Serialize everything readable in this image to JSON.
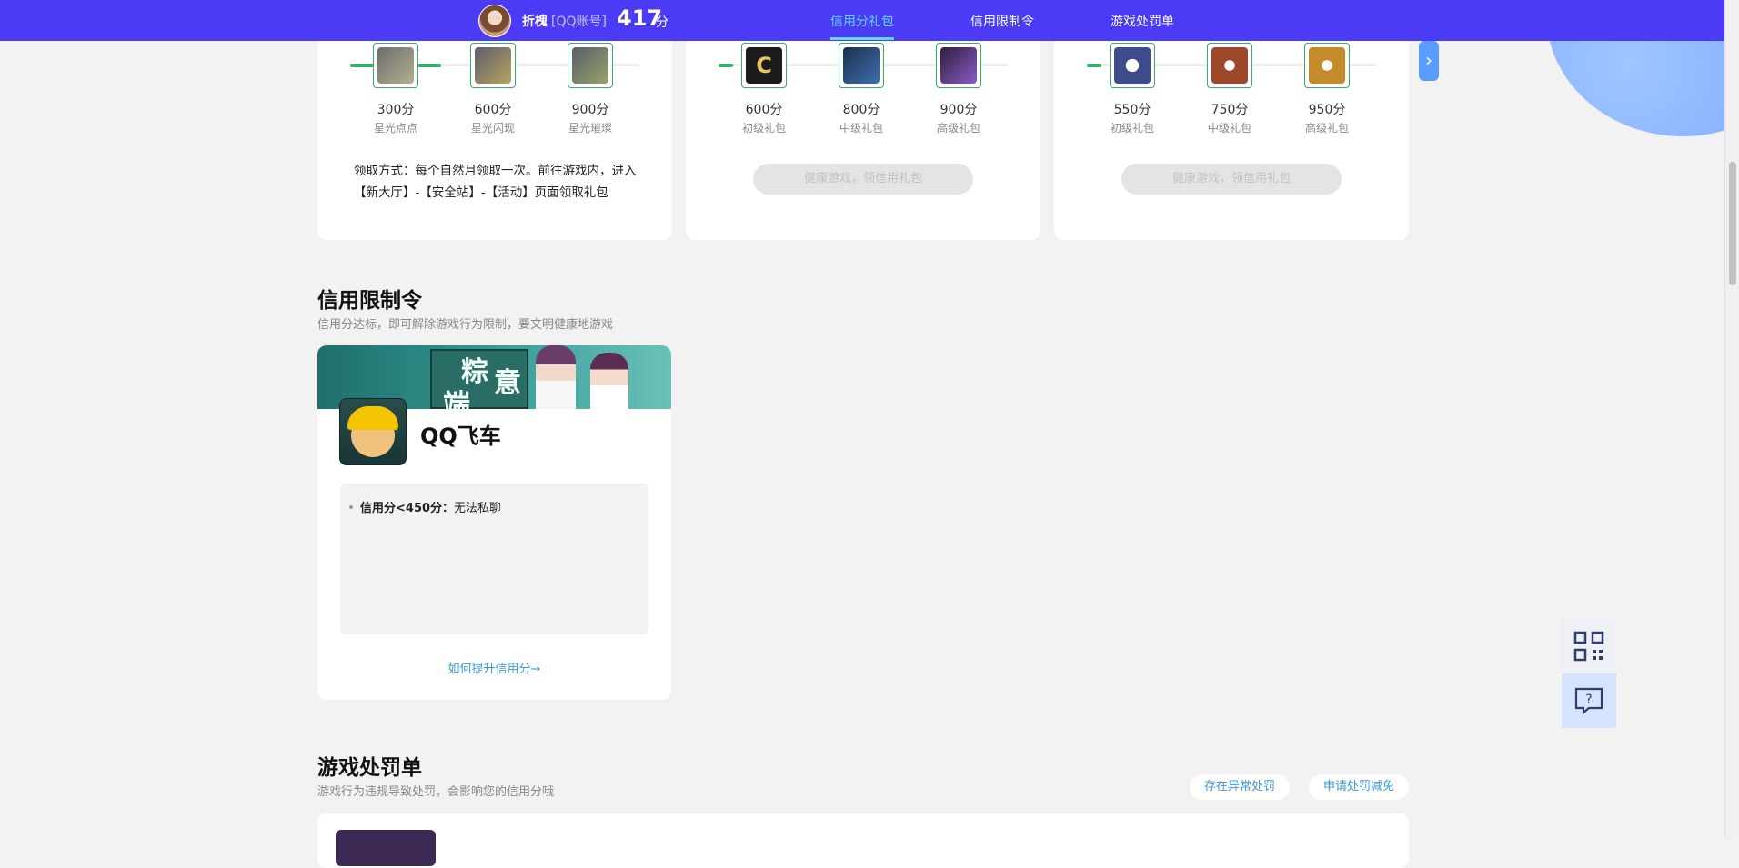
{
  "header": {
    "user_name": "折槐",
    "account_type": "[QQ账号]",
    "score": "417",
    "score_unit": "分",
    "tabs": [
      {
        "label": "信用分礼包",
        "active": true
      },
      {
        "label": "信用限制令",
        "active": false
      },
      {
        "label": "游戏处罚单",
        "active": false
      }
    ],
    "accent_color": "#4c3bf5",
    "active_tab_color": "#5fd7ff"
  },
  "gift_cards": [
    {
      "rewards": [
        {
          "points": "300分",
          "name": "星光点点",
          "icon": "starlight-dot-icon"
        },
        {
          "points": "600分",
          "name": "星光闪现",
          "icon": "starlight-flash-icon"
        },
        {
          "points": "900分",
          "name": "星光璀璨",
          "icon": "starlight-brilliant-icon"
        }
      ],
      "claim_text": "领取方式：每个自然月领取一次。前往游戏内，进入【新大厅】-【安全站】-【活动】页面领取礼包"
    },
    {
      "rewards": [
        {
          "points": "600分",
          "name": "初级礼包",
          "icon": "c-badge-icon"
        },
        {
          "points": "800分",
          "name": "中级礼包",
          "icon": "gun-icon"
        },
        {
          "points": "900分",
          "name": "高级礼包",
          "icon": "vehicle-icon"
        }
      ],
      "claim_button": "健康游戏，领信用礼包"
    },
    {
      "rewards": [
        {
          "points": "550分",
          "name": "初级礼包",
          "icon": "blue-rank-icon"
        },
        {
          "points": "750分",
          "name": "中级礼包",
          "icon": "bronze-rank-icon"
        },
        {
          "points": "950分",
          "name": "高级礼包",
          "icon": "gold-rank-icon"
        }
      ],
      "claim_button": "健康游戏，领信用礼包"
    }
  ],
  "restriction": {
    "title": "信用限制令",
    "subtitle": "信用分达标，即可解除游戏行为限制，要文明健康地游戏",
    "banner_text": [
      "粽",
      "意",
      "端"
    ],
    "game_name": "QQ飞车",
    "rule_label": "信用分<450分：",
    "rule_value": "无法私聊",
    "improve_link": "如何提升信用分"
  },
  "penalty": {
    "title": "游戏处罚单",
    "subtitle": "游戏行为违规导致处罚，会影响您的信用分哦",
    "abnormal_button": "存在异常处罚",
    "reduce_button": "申请处罚减免"
  },
  "tools": {
    "qr": "qr-code-icon",
    "help": "help-chat-icon"
  }
}
